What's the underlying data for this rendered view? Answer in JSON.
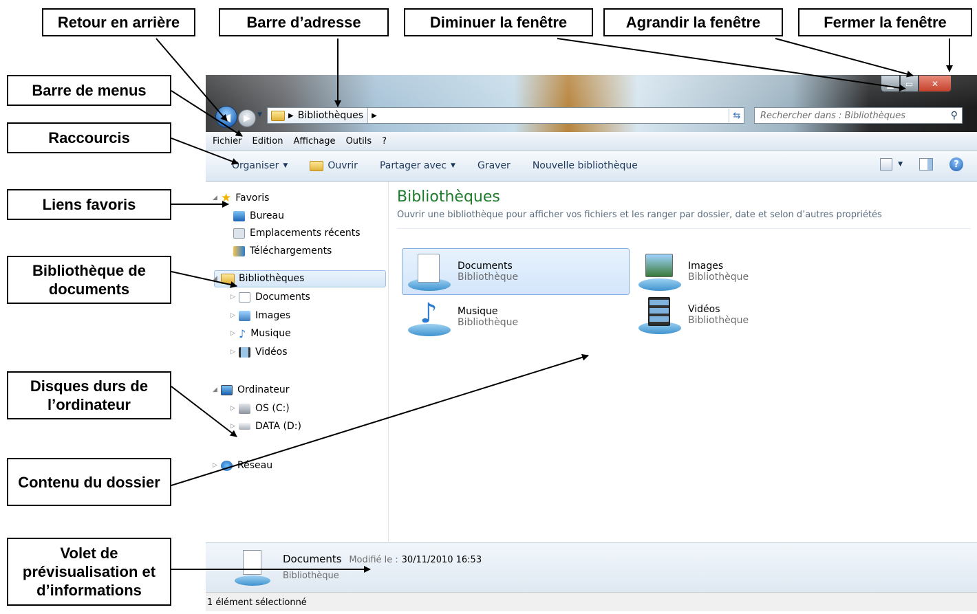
{
  "annotations": {
    "retour": "Retour en arrière",
    "barre_adresse": "Barre d’adresse",
    "diminuer": "Diminuer la fenêtre",
    "agrandir": "Agrandir la fenêtre",
    "fermer": "Fermer la fenêtre",
    "barre_menus": "Barre de menus",
    "raccourcis": "Raccourcis",
    "liens_favoris": "Liens favoris",
    "bibliotheque_documents": "Bibliothèque de documents",
    "disques": "Disques durs de l’ordinateur",
    "contenu": "Contenu du dossier",
    "volet": "Volet de prévisualisation et d’informations"
  },
  "window": {
    "address_path": "Bibliothèques",
    "search_placeholder": "Rechercher dans : Bibliothèques",
    "menu": [
      "Fichier",
      "Edition",
      "Affichage",
      "Outils",
      "?"
    ],
    "toolbar": {
      "organiser": "Organiser",
      "ouvrir": "Ouvrir",
      "partager": "Partager avec",
      "graver": "Graver",
      "nouvelle": "Nouvelle bibliothèque"
    },
    "nav": {
      "favoris": "Favoris",
      "bureau": "Bureau",
      "recents": "Emplacements récents",
      "telechargements": "Téléchargements",
      "bibliotheques": "Bibliothèques",
      "documents": "Documents",
      "images": "Images",
      "musique": "Musique",
      "videos": "Vidéos",
      "ordinateur": "Ordinateur",
      "os": "OS (C:)",
      "data": "DATA (D:)",
      "reseau": "Réseau"
    },
    "content": {
      "title": "Bibliothèques",
      "subtitle": "Ouvrir une bibliothèque pour afficher vos fichiers et les ranger par dossier, date et selon d’autres propriétés",
      "libraries": [
        {
          "name": "Documents",
          "type": "Bibliothèque"
        },
        {
          "name": "Images",
          "type": "Bibliothèque"
        },
        {
          "name": "Musique",
          "type": "Bibliothèque"
        },
        {
          "name": "Vidéos",
          "type": "Bibliothèque"
        }
      ]
    },
    "preview": {
      "name": "Documents",
      "modified_label": "Modifié le :",
      "modified_value": "30/11/2010 16:53",
      "type": "Bibliothèque"
    },
    "status": "1 élément sélectionné"
  },
  "colors": {
    "content_title": "#1e7b2c",
    "selection": "#d4e6fb",
    "close_button": "#c4412b"
  }
}
